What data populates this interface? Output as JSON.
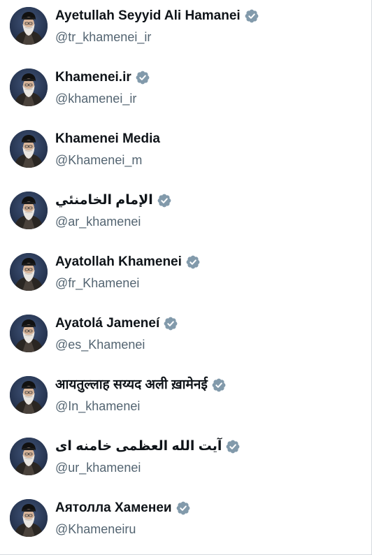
{
  "accounts": [
    {
      "name": "Ayetullah Seyyid Ali Hamanei",
      "handle": "@tr_khamenei_ir",
      "verified": true
    },
    {
      "name": "Khamenei.ir",
      "handle": "@khamenei_ir",
      "verified": true
    },
    {
      "name": "Khamenei Media",
      "handle": "@Khamenei_m",
      "verified": false
    },
    {
      "name": "الإمام الخامنئي",
      "handle": "@ar_khamenei",
      "verified": true
    },
    {
      "name": "Ayatollah Khamenei",
      "handle": "@fr_Khamenei",
      "verified": true
    },
    {
      "name": "Ayatolá Jameneí",
      "handle": "@es_Khamenei",
      "verified": true
    },
    {
      "name": "आयतुल्लाह सय्यद अली ख़ामेनई",
      "handle": "@In_khamenei",
      "verified": true
    },
    {
      "name": "آیت الله العظمی خامنه ای",
      "handle": "@ur_khamenei",
      "verified": true
    },
    {
      "name": "Аятолла Хаменеи",
      "handle": "@Khameneiru",
      "verified": true
    }
  ],
  "colors": {
    "name": "#0f1419",
    "handle": "#536471",
    "badge": "#829aab",
    "avatar_bg": "#2b3a55"
  }
}
